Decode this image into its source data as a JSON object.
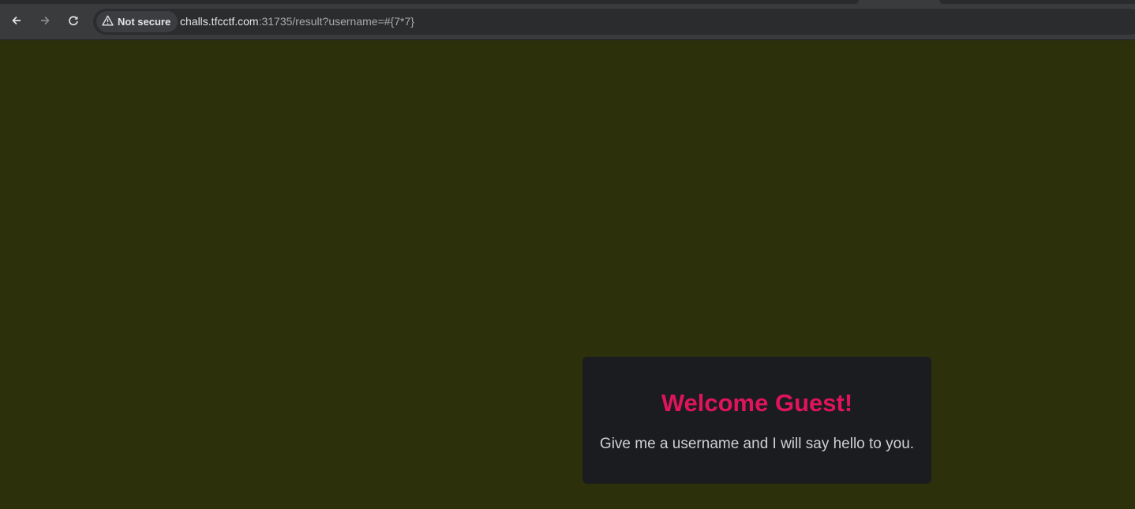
{
  "browser": {
    "security_label": "Not secure",
    "url_host": "challs.tfcctf.com",
    "url_rest": ":31735/result?username=#{7*7}",
    "icons": {
      "back": "arrow-left-icon",
      "forward": "arrow-right-icon",
      "reload": "reload-icon",
      "security": "warning-triangle-icon"
    }
  },
  "page": {
    "background_color": "#2c310b",
    "card": {
      "title": "Welcome Guest!",
      "message": "Give me a username and I will say hello to you.",
      "title_color": "#e0145a",
      "background_color": "#1b1c1f"
    }
  }
}
